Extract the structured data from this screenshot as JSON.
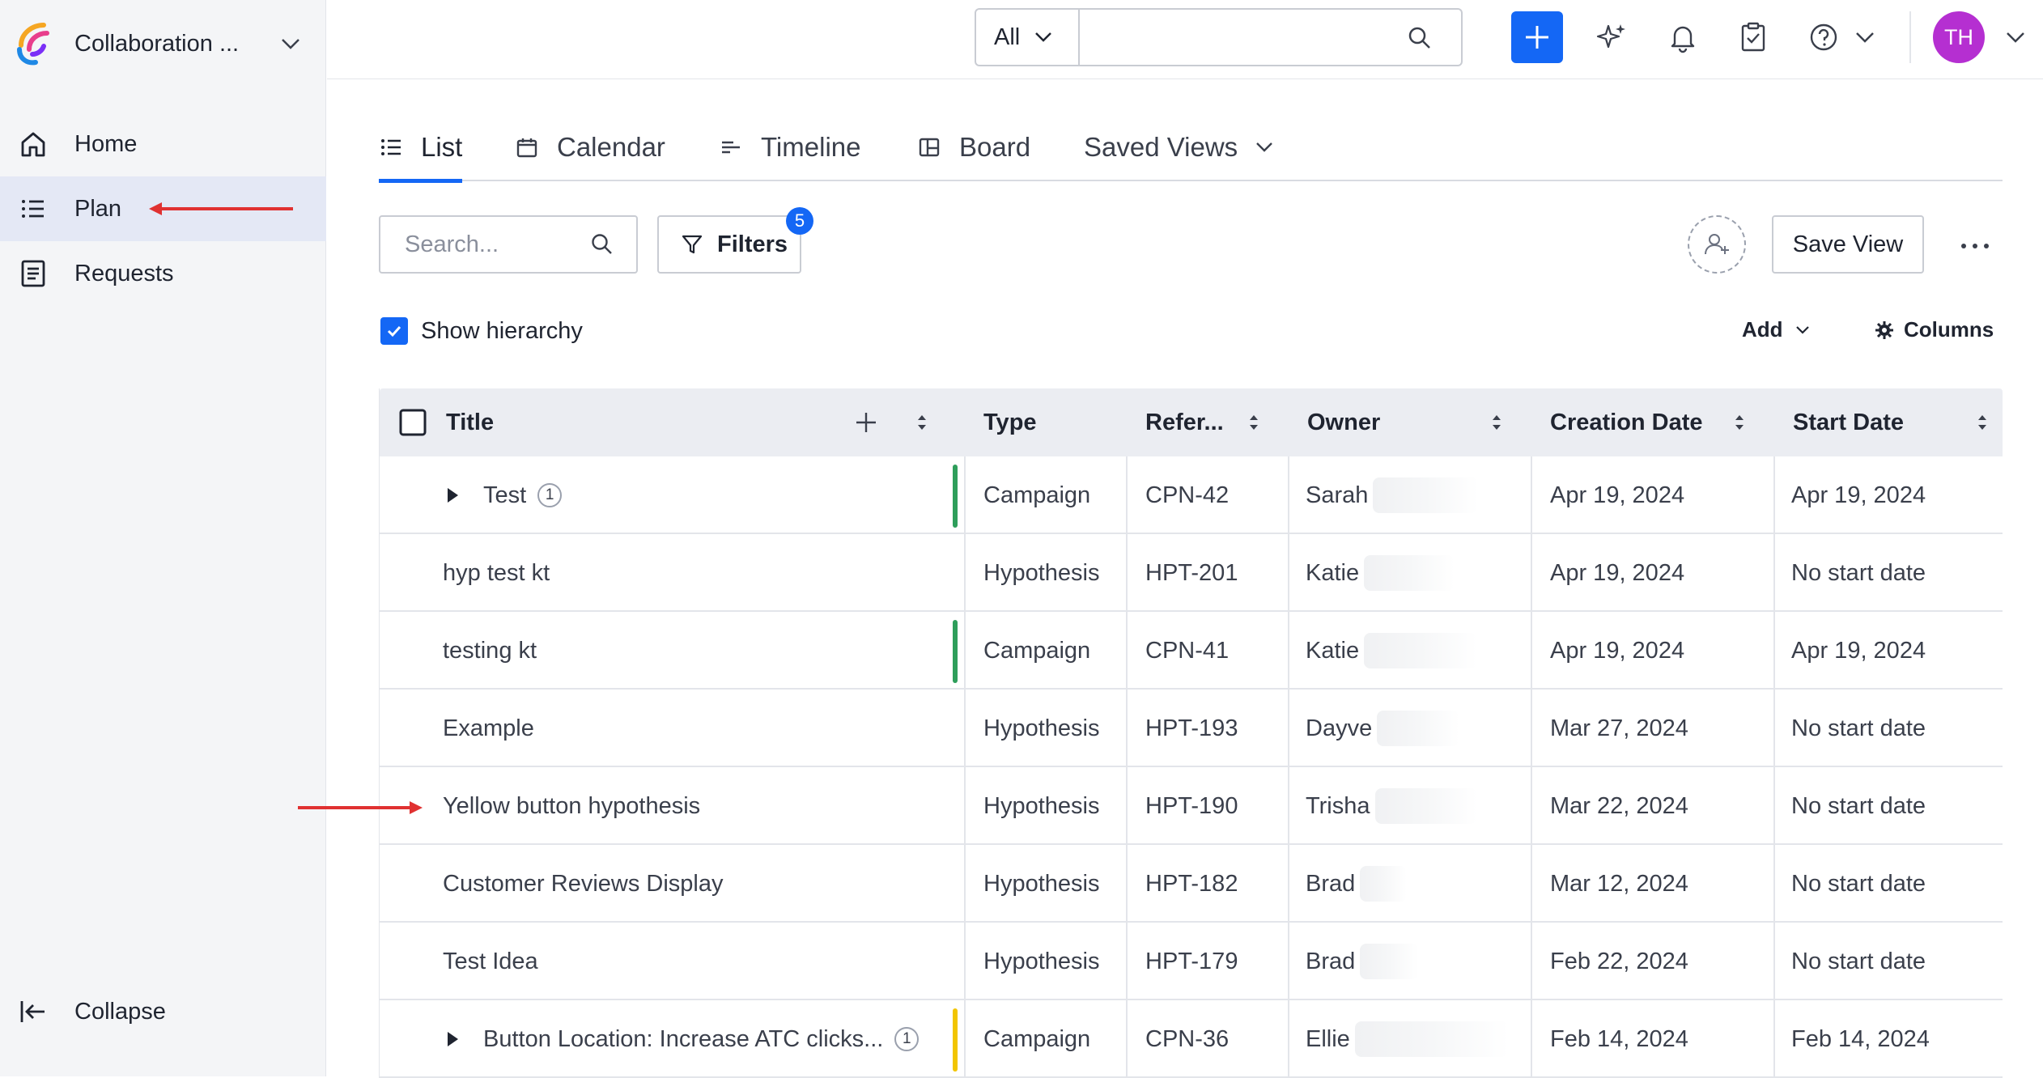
{
  "app": {
    "workspace_name": "Collaboration ...",
    "nav": [
      {
        "label": "Home",
        "icon": "home-icon"
      },
      {
        "label": "Plan",
        "icon": "list-icon",
        "active": true
      },
      {
        "label": "Requests",
        "icon": "document-icon"
      }
    ],
    "collapse_label": "Collapse"
  },
  "topbar": {
    "scope_label": "All",
    "search_value": "",
    "avatar_initials": "TH",
    "colors": {
      "primary": "#1467f5",
      "avatar": "#b52fd1"
    }
  },
  "tabs": [
    {
      "label": "List",
      "icon": "list-icon",
      "active": true
    },
    {
      "label": "Calendar",
      "icon": "calendar-icon"
    },
    {
      "label": "Timeline",
      "icon": "timeline-icon"
    },
    {
      "label": "Board",
      "icon": "board-icon"
    },
    {
      "label": "Saved Views",
      "icon": "chevron-down-icon"
    }
  ],
  "toolbar": {
    "search_placeholder": "Search...",
    "filters_label": "Filters",
    "filters_count": "5",
    "save_view_label": "Save View",
    "show_hierarchy_label": "Show hierarchy",
    "show_hierarchy_checked": true,
    "add_label": "Add",
    "columns_label": "Columns"
  },
  "table": {
    "headers": [
      "Title",
      "Type",
      "Refer...",
      "Owner",
      "Creation Date",
      "Start Date"
    ],
    "rows": [
      {
        "title": "Test",
        "children": "1",
        "expandable": true,
        "accent": "#2e9e5b",
        "type": "Campaign",
        "ref": "CPN-42",
        "owner": "Sarah",
        "created": "Apr 19, 2024",
        "start": "Apr 19, 2024"
      },
      {
        "title": "hyp test kt",
        "children": "",
        "expandable": false,
        "accent": "",
        "type": "Hypothesis",
        "ref": "HPT-201",
        "owner": "Katie",
        "created": "Apr 19, 2024",
        "start": "No start date"
      },
      {
        "title": "testing kt",
        "children": "",
        "expandable": false,
        "accent": "#2e9e5b",
        "type": "Campaign",
        "ref": "CPN-41",
        "owner": "Katie",
        "created": "Apr 19, 2024",
        "start": "Apr 19, 2024"
      },
      {
        "title": "Example",
        "children": "",
        "expandable": false,
        "accent": "",
        "type": "Hypothesis",
        "ref": "HPT-193",
        "owner": "Dayve",
        "created": "Mar 27, 2024",
        "start": "No start date"
      },
      {
        "title": "Yellow button hypothesis",
        "children": "",
        "expandable": false,
        "accent": "",
        "type": "Hypothesis",
        "ref": "HPT-190",
        "owner": "Trisha",
        "created": "Mar 22, 2024",
        "start": "No start date"
      },
      {
        "title": "Customer Reviews Display",
        "children": "",
        "expandable": false,
        "accent": "",
        "type": "Hypothesis",
        "ref": "HPT-182",
        "owner": "Brad",
        "created": "Mar 12, 2024",
        "start": "No start date"
      },
      {
        "title": "Test Idea",
        "children": "",
        "expandable": false,
        "accent": "",
        "type": "Hypothesis",
        "ref": "HPT-179",
        "owner": "Brad",
        "created": "Feb 22, 2024",
        "start": "No start date"
      },
      {
        "title": "Button Location: Increase ATC clicks...",
        "children": "1",
        "expandable": true,
        "accent": "#f2c500",
        "type": "Campaign",
        "ref": "CPN-36",
        "owner": "Ellie",
        "created": "Feb 14, 2024",
        "start": "Feb 14, 2024"
      }
    ]
  },
  "annotations": {
    "arrow_color": "#e03131"
  }
}
